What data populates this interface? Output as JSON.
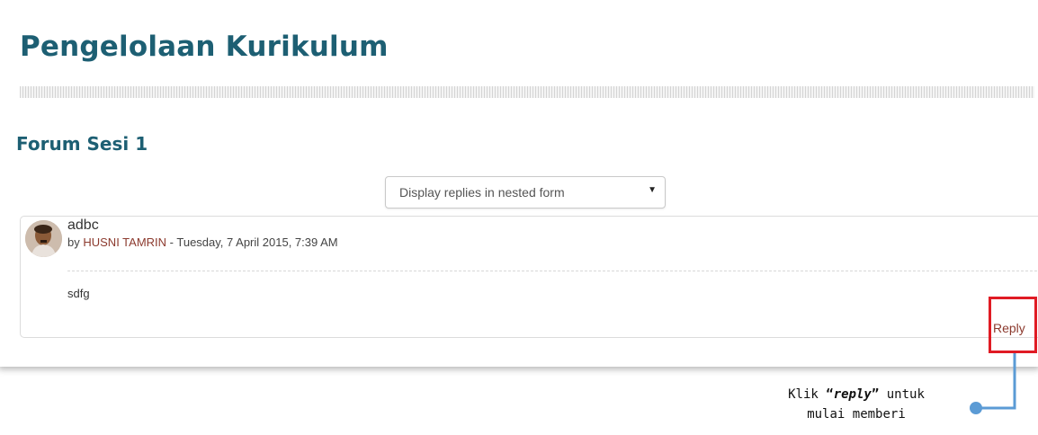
{
  "page": {
    "title": "Pengelolaan Kurikulum"
  },
  "forum": {
    "title": "Forum Sesi 1",
    "display_mode": {
      "selected": "Display replies in nested form",
      "arrow_icon": "triangle-down-icon"
    }
  },
  "post": {
    "avatar_icon": "user-photo-avatar",
    "subject": "adbc",
    "by_prefix": "by",
    "author": "HUSNI TAMRIN",
    "date_separator": " - ",
    "date": "Tuesday, 7 April 2015, 7:39 AM",
    "body": "sdfg",
    "reply_label": "Reply"
  },
  "annotation": {
    "line1_prefix": "Klik ",
    "quote_open": "“",
    "keyword": "reply",
    "quote_close": "”",
    "line1_suffix": " untuk",
    "line2": "mulai memberi",
    "highlight_color": "#e01b24",
    "connector_color": "#5b9bd5"
  }
}
